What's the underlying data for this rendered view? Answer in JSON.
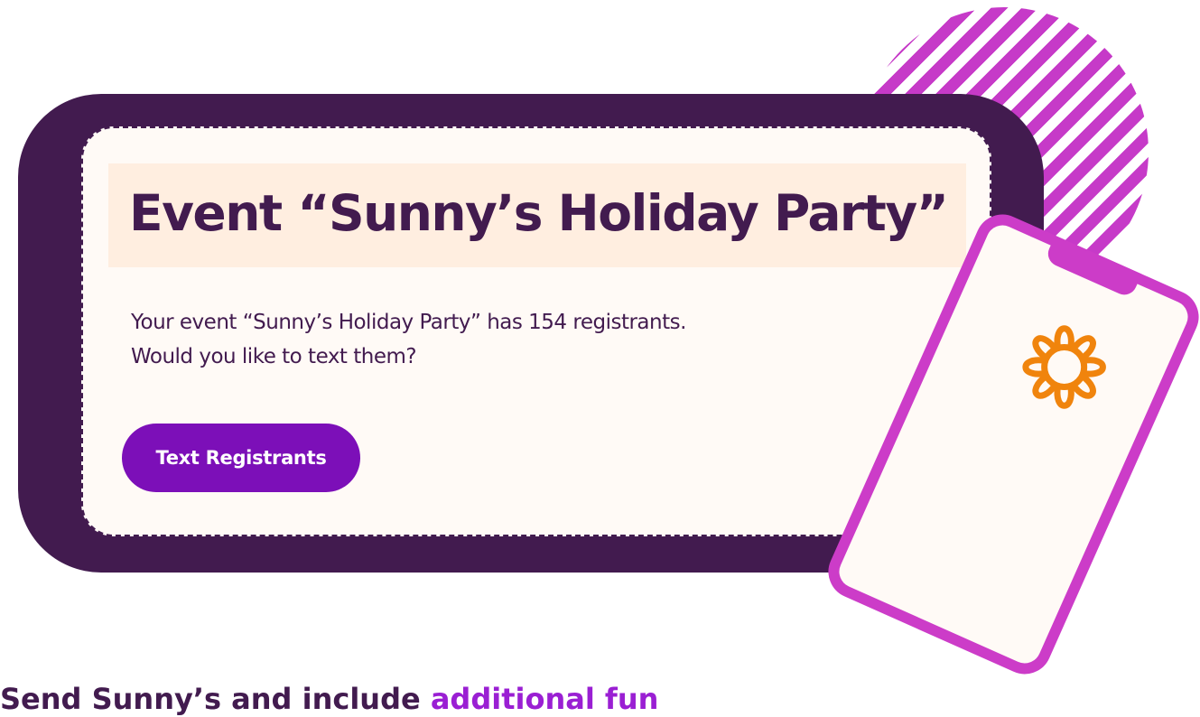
{
  "event_card": {
    "title": "Event “Sunny’s Holiday Party”",
    "message_line1": "Your event “Sunny’s Holiday Party” has 154 registrants.",
    "message_line2": "Would you like to text them?",
    "button_label": "Text Registrants"
  },
  "footer": {
    "text_start": "Send Sunny’s and include ",
    "text_accent": "additional fun"
  },
  "illustration": {
    "phone_icon": "sun-logo-icon",
    "background_icon": "striped-circle"
  },
  "colors": {
    "dark_purple": "#421b4f",
    "button_purple": "#7c0fb8",
    "magenta": "#cc3cc8",
    "orange": "#f0840d",
    "cream": "#fffaf6",
    "peach": "#ffeee0"
  }
}
